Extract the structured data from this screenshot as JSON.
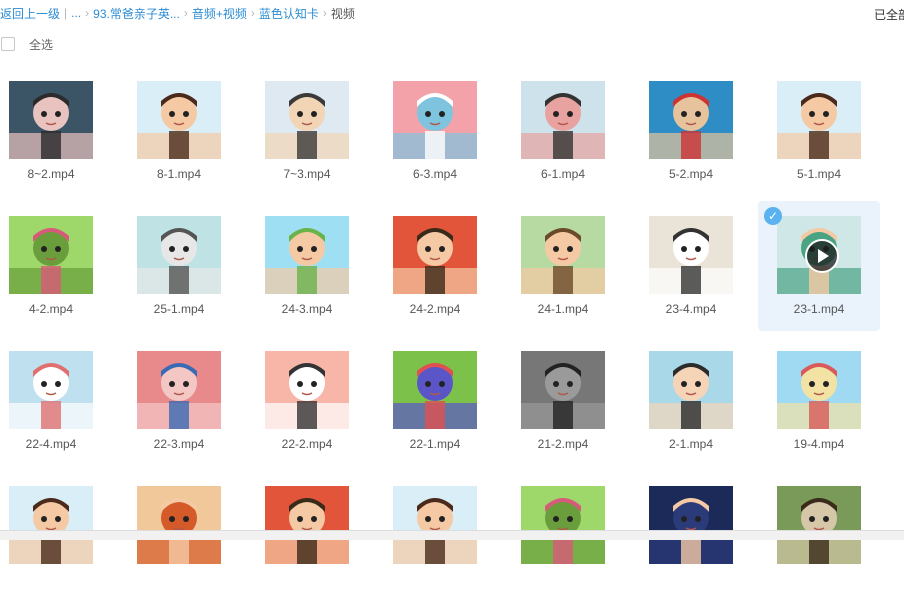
{
  "breadcrumb": {
    "back": "返回上一级",
    "divider": "|",
    "ellipsis": "...",
    "items": [
      "93.常爸亲子英...",
      "音频+视频",
      "蓝色认知卡"
    ],
    "current": "视频"
  },
  "selection": {
    "count_text": "已全部",
    "select_all": "全选"
  },
  "colors": {
    "link": "#2c8cd4",
    "selected_tile_bg": "#eaf2fb",
    "check_badge": "#5ab3f0"
  },
  "files": [
    {
      "name": "8~2.mp4",
      "scene": "shop"
    },
    {
      "name": "8-1.mp4",
      "scene": "face"
    },
    {
      "name": "7~3.mp4",
      "scene": "store"
    },
    {
      "name": "6-3.mp4",
      "scene": "kitchen"
    },
    {
      "name": "6-1.mp4",
      "scene": "room"
    },
    {
      "name": "5-2.mp4",
      "scene": "aquarium"
    },
    {
      "name": "5-1.mp4",
      "scene": "face"
    },
    {
      "name": "4-2.mp4",
      "scene": "park"
    },
    {
      "name": "25-1.mp4",
      "scene": "street"
    },
    {
      "name": "24-3.mp4",
      "scene": "cry"
    },
    {
      "name": "24-2.mp4",
      "scene": "tilt"
    },
    {
      "name": "24-1.mp4",
      "scene": "forest"
    },
    {
      "name": "23-4.mp4",
      "scene": "rotated"
    },
    {
      "name": "23-1.mp4",
      "scene": "doctor",
      "selected": true
    },
    {
      "name": "22-4.mp4",
      "scene": "dentist"
    },
    {
      "name": "22-3.mp4",
      "scene": "sofa"
    },
    {
      "name": "22-2.mp4",
      "scene": "bath"
    },
    {
      "name": "22-1.mp4",
      "scene": "ballpit"
    },
    {
      "name": "21-2.mp4",
      "scene": "elevator"
    },
    {
      "name": "2-1.mp4",
      "scene": "woman"
    },
    {
      "name": "19-4.mp4",
      "scene": "beach"
    },
    {
      "name": "",
      "scene": "face"
    },
    {
      "name": "",
      "scene": "market"
    },
    {
      "name": "",
      "scene": "tilt"
    },
    {
      "name": "",
      "scene": "face"
    },
    {
      "name": "",
      "scene": "park"
    },
    {
      "name": "",
      "scene": "night"
    },
    {
      "name": "",
      "scene": "window"
    }
  ]
}
